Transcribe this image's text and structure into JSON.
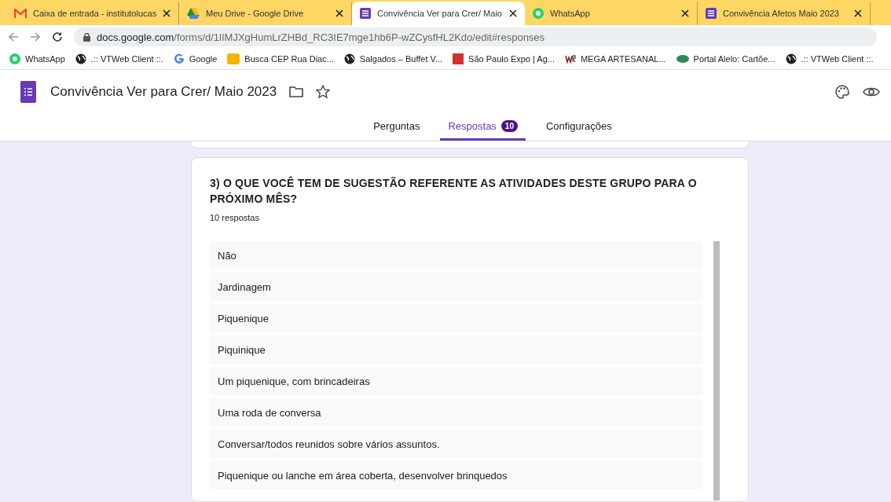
{
  "browser_tabs": [
    {
      "title": "Caixa de entrada - institutolucas",
      "kind": "mail",
      "selected": false
    },
    {
      "title": "Meu Drive - Google Drive",
      "kind": "drive",
      "selected": false
    },
    {
      "title": "Convivência Ver para Crer/ Maio",
      "kind": "form",
      "selected": true
    },
    {
      "title": "WhatsApp",
      "kind": "chat",
      "selected": false
    },
    {
      "title": "Convivência Afetos Maio 2023",
      "kind": "form",
      "selected": false
    }
  ],
  "address": {
    "host": "docs.google.com",
    "path": "/forms/d/1lIMJXgHumLrZHBd_RC3IE7mge1hb6P-wZCysfHL2Kdo/edit#responses"
  },
  "bookmarks": [
    {
      "label": "WhatsApp",
      "kind": "chat"
    },
    {
      "label": ".:: VTWeb Client ::.",
      "kind": "globe"
    },
    {
      "label": "Google",
      "kind": "g"
    },
    {
      "label": "Busca CEP Rua Diac...",
      "kind": "cep"
    },
    {
      "label": "Salgados – Buffet V...",
      "kind": "globe"
    },
    {
      "label": "São Paulo Expo | Ag...",
      "kind": "red"
    },
    {
      "label": "MEGA ARTESANAL...",
      "kind": "wr"
    },
    {
      "label": "Portal Alelo: Cartõe...",
      "kind": "alelo"
    },
    {
      "label": ".:: VTWeb Client ::.",
      "kind": "globe"
    }
  ],
  "form": {
    "title": "Convivência Ver para Crer/ Maio 2023"
  },
  "tabs": [
    {
      "label": "Perguntas",
      "selected": false
    },
    {
      "label": "Respostas",
      "badge": "10",
      "selected": true
    },
    {
      "label": "Configurações",
      "selected": false
    }
  ],
  "question": {
    "title": "3) O QUE VOCÊ TEM DE SUGESTÃO REFERENTE AS ATIVIDADES DESTE GRUPO PARA O PRÓXIMO MÊS?",
    "count": "10 respostas",
    "answers": [
      "Não",
      "Jardinagem",
      "Piquenique",
      "Piquinique",
      "Um piquenique, com brincadeiras",
      "Uma roda de conversa",
      "Conversar/todos reunidos sobre vários assuntos.",
      "Piquenique ou lanche em área coberta, desenvolver brinquedos"
    ]
  }
}
